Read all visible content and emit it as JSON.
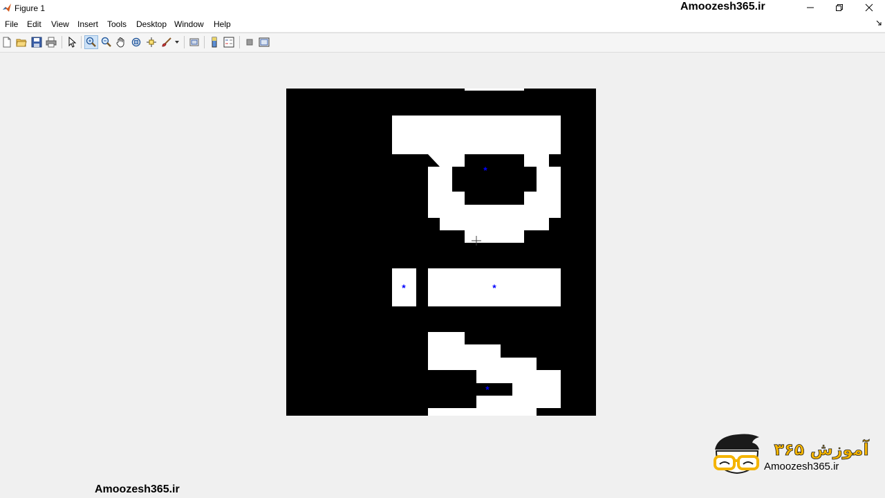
{
  "window": {
    "title": "Figure 1",
    "app_icon": "matlab-icon",
    "watermark": "Amoozesh365.ir",
    "controls": [
      "minimize-icon",
      "restore-icon",
      "close-icon"
    ]
  },
  "menu": {
    "items": [
      "File",
      "Edit",
      "View",
      "Insert",
      "Tools",
      "Desktop",
      "Window",
      "Help"
    ]
  },
  "toolbar": {
    "buttons": [
      "new-figure-icon",
      "open-file-icon",
      "save-figure-icon",
      "print-figure-icon",
      "edit-plot-icon",
      "zoom-in-icon",
      "zoom-out-icon",
      "pan-icon",
      "rotate-3d-icon",
      "data-cursor-icon",
      "brush-icon",
      "link-plot-icon",
      "insert-colorbar-icon",
      "insert-legend-icon",
      "hide-plot-tools-icon",
      "show-plot-tools-icon"
    ],
    "active": "zoom-in-icon"
  },
  "image": {
    "description_colors": {
      "background": "#000000",
      "foreground": "#ffffff",
      "marker": "#0000ff"
    },
    "centroid_marker": "*"
  },
  "watermarks": {
    "bottom_left": "Amoozesh365.ir",
    "logo_caption": "Amoozesh365.ir",
    "logo_persian": "آموزش ۳۶۵"
  }
}
